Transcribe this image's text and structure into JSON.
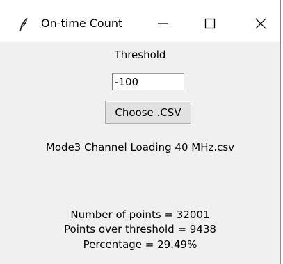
{
  "window": {
    "title": "On-time Count",
    "icons": {
      "app": "feather-icon",
      "minimize": "minimize-icon",
      "maximize": "maximize-icon",
      "close": "close-icon"
    }
  },
  "form": {
    "threshold_label": "Threshold",
    "threshold_value": "-100",
    "choose_button_label": "Choose .CSV",
    "selected_file": "Mode3 Channel Loading 40 MHz.csv"
  },
  "results": {
    "points_text": "Number of points = 32001",
    "over_threshold_text": "Points over threshold = 9438",
    "percentage_text": "Percentage = 29.49%"
  }
}
